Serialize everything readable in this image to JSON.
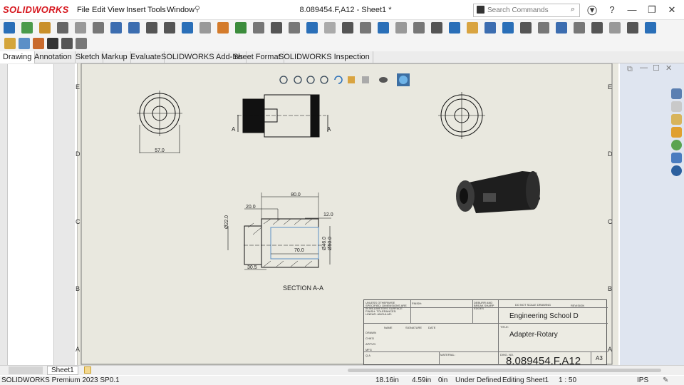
{
  "app": {
    "brand": "SOLIDWORKS",
    "document_title": "8.089454.F,A12 - Sheet1 *"
  },
  "menu": [
    "File",
    "Edit",
    "View",
    "Insert",
    "Tools",
    "Window"
  ],
  "search": {
    "placeholder": "Search Commands"
  },
  "tabs": [
    "Drawing",
    "Annotation",
    "Sketch",
    "Markup",
    "Evaluate",
    "SOLIDWORKS Add-Ins",
    "Sheet Format",
    "SOLIDWORKS Inspection"
  ],
  "active_tab": "Drawing",
  "border_rows": [
    "E",
    "D",
    "C",
    "B",
    "A"
  ],
  "drawing": {
    "dim_57": "57.0",
    "dim_80": "80.0",
    "dim_20": "20.0",
    "dim_12": "12.0",
    "dim_22": "Ø22.0",
    "dim_46": "Ø46.0",
    "dim_50": "Ø50.0",
    "dim_70": "70.0",
    "dim_30_5": "30.5",
    "section_label": "SECTION A-A",
    "arrow_label": "A"
  },
  "title_block": {
    "company": "Engineering School D",
    "title": "Adapter-Rotary",
    "dwg_no": "8.089454.F,A12",
    "size": "A3",
    "notes": "UNLESS OTHERWISE SPECIFIED: DIMENSIONS ARE IN MILLIMETERS SURFACE FINISH: TOLERANCES: LINEAR: ANGULAR:",
    "finish_label": "FINISH:",
    "deburr_label": "DEBURR AND BREAK SHARP EDGES",
    "do_not_scale": "DO NOT SCALE DRAWING",
    "revision_label": "REVISION",
    "title_label": "TITLE:",
    "dwg_no_label": "DWG. NO.",
    "material_label": "MATERIAL:",
    "col_name": "NAME",
    "col_signature": "SIGNATURE",
    "col_date": "DATE",
    "rows": [
      "DRAWN",
      "CHK'D",
      "APPV'D",
      "MFG",
      "Q.A"
    ]
  },
  "sheet_tab": "Sheet1",
  "status": {
    "product": "SOLIDWORKS Premium 2023 SP0.1",
    "x": "18.16in",
    "y": "4.59in",
    "z": "0in",
    "definition": "Under Defined",
    "editing": "Editing Sheet1",
    "scale": "1 : 50",
    "units": "IPS"
  },
  "colors": {
    "brand": "#d71920",
    "sheet_bg": "#e9e8df",
    "part": "#2b2b2b"
  }
}
